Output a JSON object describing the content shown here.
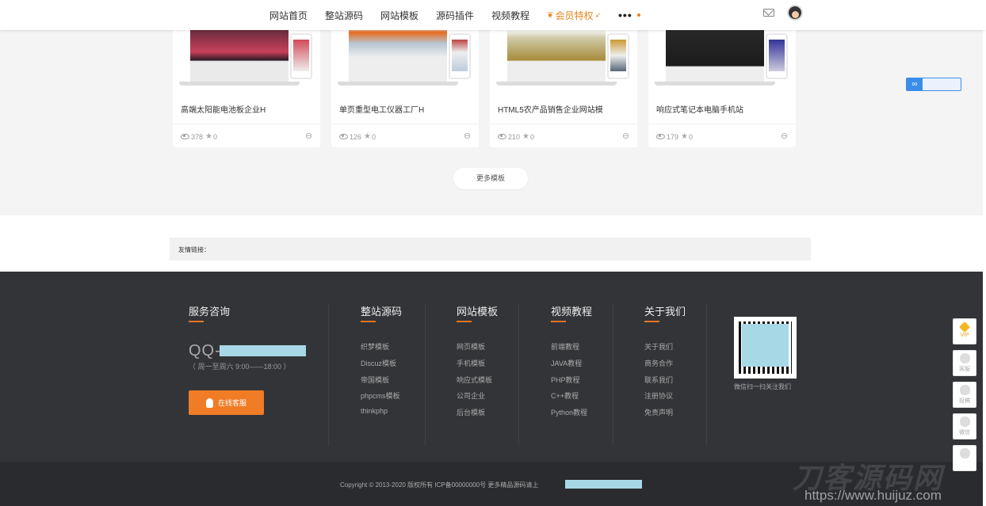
{
  "nav": {
    "items": [
      "网站首页",
      "整站源码",
      "网站模板",
      "源码插件",
      "视频教程"
    ],
    "vip": "会员特权",
    "more": "•••"
  },
  "cards": [
    {
      "title": "高端太阳能电池板企业H",
      "views": "378",
      "stars": "0"
    },
    {
      "title": "单页重型电工仪器工厂H",
      "views": "126",
      "stars": "0"
    },
    {
      "title": "HTML5农产品销售企业网站模",
      "views": "210",
      "stars": "0"
    },
    {
      "title": "响应式笔记本电脑手机站",
      "views": "179",
      "stars": "0"
    }
  ],
  "more_button": "更多模板",
  "friends_label": "友情链接：",
  "footer": {
    "service": {
      "title": "服务咨询",
      "qq_prefix": "QQ-",
      "hours": "（ 周一至周六 9:00——18:00 ）",
      "button": "在线客服"
    },
    "columns": [
      {
        "title": "整站源码",
        "links": [
          "织梦模板",
          "Discuz模板",
          "帝国模板",
          "phpcms模板",
          "thinkphp"
        ]
      },
      {
        "title": "网站模板",
        "links": [
          "网页模板",
          "手机模板",
          "响应式模板",
          "公司企业",
          "后台模板"
        ]
      },
      {
        "title": "视频教程",
        "links": [
          "前端教程",
          "JAVA教程",
          "PHP教程",
          "C++教程",
          "Python教程"
        ]
      },
      {
        "title": "关于我们",
        "links": [
          "关于我们",
          "商务合作",
          "联系我们",
          "注册协议",
          "免责声明"
        ]
      }
    ],
    "qr_caption": "微信扫一扫关注我们",
    "copyright": "Copyright © 2013-2020 版权所有 ICP备00000000号 更多精品源码请上",
    "watermark": "刀客源码网",
    "watermark_url": "https://www.huijuz.com"
  },
  "side": [
    {
      "label": "VIP",
      "icon": "diamond-icon"
    },
    {
      "label": "客服",
      "icon": "support-icon"
    },
    {
      "label": "投稿",
      "icon": "mail-icon"
    },
    {
      "label": "微信",
      "icon": "wechat-icon"
    },
    {
      "label": "",
      "icon": "menu-icon"
    }
  ],
  "colors": {
    "accent": "#f07c26",
    "footer_bg": "#333437",
    "mask": "#a7d8e6"
  }
}
